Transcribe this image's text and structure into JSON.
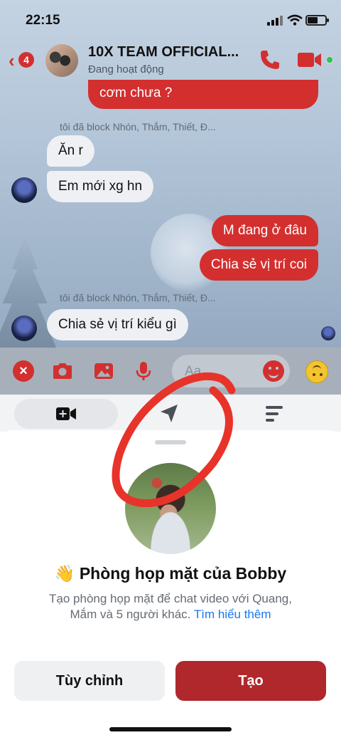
{
  "status_bar": {
    "time": "22:15"
  },
  "header": {
    "back_badge": "4",
    "title": "10X TEAM OFFICIAL...",
    "subtitle": "Đang hoạt động"
  },
  "messages": [
    {
      "id": "m1",
      "side": "out",
      "text": "cơm chưa ?"
    },
    {
      "id": "n1",
      "type": "note",
      "text": "tôi đã block Nhón, Thắm, Thiết, Đ..."
    },
    {
      "id": "m2",
      "side": "in",
      "text": "Ăn r"
    },
    {
      "id": "m3",
      "side": "in",
      "text": "Em mới xg hn"
    },
    {
      "id": "m4",
      "side": "out",
      "text": "M đang ở đâu"
    },
    {
      "id": "m5",
      "side": "out",
      "text": "Chia sẻ vị trí coi"
    },
    {
      "id": "n2",
      "type": "note",
      "text": "tôi đã block Nhón, Thắm, Thiết, Đ..."
    },
    {
      "id": "m6",
      "side": "in",
      "text": "Chia sẻ vị trí kiểu gì"
    }
  ],
  "composer": {
    "placeholder": "Aa"
  },
  "sheet": {
    "title": "👋 Phòng họp mặt của Bobby",
    "description": "Tạo phòng họp mặt để chat video với Quang, Mắm và 5 người khác.",
    "learn_more": "Tìm hiểu thêm",
    "customize_label": "Tùy chỉnh",
    "create_label": "Tạo"
  },
  "colors": {
    "accent": "#d32f2f",
    "create_button": "#b0282c",
    "link": "#1877f2",
    "online": "#31c24d"
  },
  "icons": [
    "back-chevron-icon",
    "phone-icon",
    "video-camera-icon",
    "close-icon",
    "camera-icon",
    "image-icon",
    "microphone-icon",
    "emoji-icon",
    "upside-down-face-icon",
    "video-plus-icon",
    "location-arrow-icon",
    "menu-lines-icon"
  ]
}
